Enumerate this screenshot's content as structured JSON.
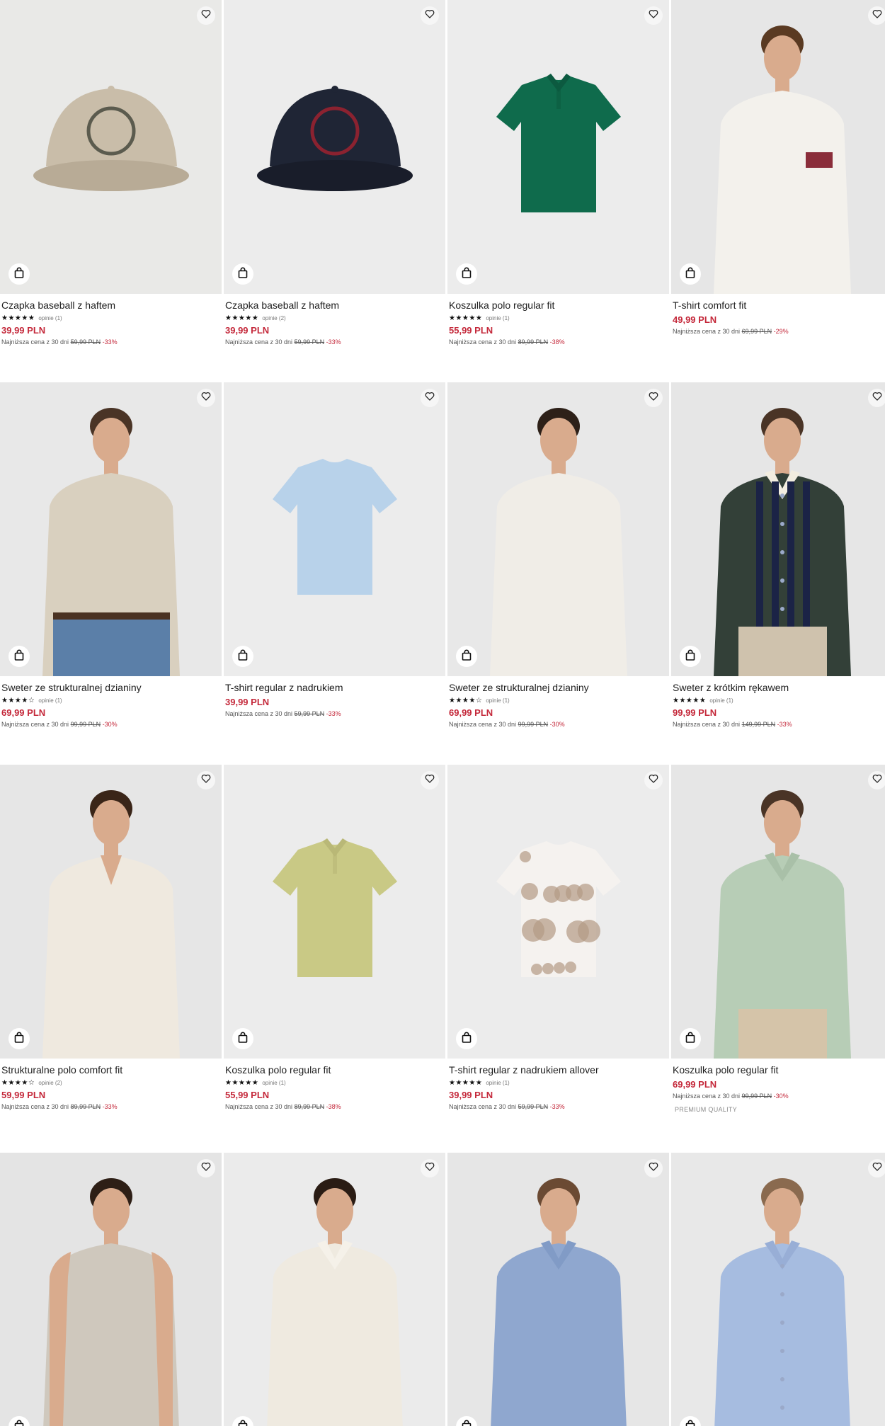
{
  "currency": "PLN",
  "lowest_label": "Najniższa cena z 30 dni",
  "reviews_word": "opinie",
  "products": [
    {
      "name": "Czapka baseball z haftem",
      "price": "39,99 PLN",
      "old_price": "59,99 PLN",
      "discount": "-33%",
      "stars": "★★★★★",
      "reviews": "opinie (1)",
      "bg": "#e9e9e7",
      "item": "cap-beige"
    },
    {
      "name": "Czapka baseball z haftem",
      "price": "39,99 PLN",
      "old_price": "59,99 PLN",
      "discount": "-33%",
      "stars": "★★★★★",
      "reviews": "opinie (2)",
      "bg": "#ececec",
      "item": "cap-navy"
    },
    {
      "name": "Koszulka polo regular fit",
      "price": "55,99 PLN",
      "old_price": "89,99 PLN",
      "discount": "-38%",
      "stars": "★★★★★",
      "reviews": "opinie (1)",
      "bg": "#ececec",
      "item": "polo-green"
    },
    {
      "name": "T-shirt comfort fit",
      "price": "49,99 PLN",
      "old_price": "69,99 PLN",
      "discount": "-29%",
      "stars": "",
      "reviews": "",
      "bg": "#e6e6e6",
      "item": "model-tee-white"
    },
    {
      "name": "Sweter ze strukturalnej dzianiny",
      "price": "69,99 PLN",
      "old_price": "99,99 PLN",
      "discount": "-30%",
      "stars": "★★★★☆",
      "reviews": "opinie (1)",
      "bg": "#e8e8e8",
      "item": "model-sweater-beige"
    },
    {
      "name": "T-shirt regular z nadrukiem",
      "price": "39,99 PLN",
      "old_price": "59,99 PLN",
      "discount": "-33%",
      "stars": "",
      "reviews": "",
      "bg": "#ececec",
      "item": "tee-lightblue"
    },
    {
      "name": "Sweter ze strukturalnej dzianiny",
      "price": "69,99 PLN",
      "old_price": "99,99 PLN",
      "discount": "-30%",
      "stars": "★★★★☆",
      "reviews": "opinie (1)",
      "bg": "#e8e8e8",
      "item": "model-sweater-white"
    },
    {
      "name": "Sweter z krótkim rękawem",
      "price": "99,99 PLN",
      "old_price": "149,99 PLN",
      "discount": "-33%",
      "stars": "★★★★★",
      "reviews": "opinie (1)",
      "bg": "#e6e6e6",
      "item": "model-stripe-shirt"
    },
    {
      "name": "Strukturalne polo comfort fit",
      "price": "59,99 PLN",
      "old_price": "89,99 PLN",
      "discount": "-33%",
      "stars": "★★★★☆",
      "reviews": "opinie (2)",
      "bg": "#e6e6e6",
      "item": "model-polo-cream"
    },
    {
      "name": "Koszulka polo regular fit",
      "price": "55,99 PLN",
      "old_price": "89,99 PLN",
      "discount": "-38%",
      "stars": "★★★★★",
      "reviews": "opinie (1)",
      "bg": "#ececec",
      "item": "polo-olive"
    },
    {
      "name": "T-shirt regular z nadrukiem allover",
      "price": "39,99 PLN",
      "old_price": "59,99 PLN",
      "discount": "-33%",
      "stars": "★★★★★",
      "reviews": "opinie (1)",
      "bg": "#ececec",
      "item": "tee-print"
    },
    {
      "name": "Koszulka polo regular fit",
      "price": "69,99 PLN",
      "old_price": "99,99 PLN",
      "discount": "-30%",
      "stars": "",
      "reviews": "",
      "bg": "#e6e6e6",
      "item": "model-polo-mint",
      "extra": "PREMIUM QUALITY"
    },
    {
      "name": "",
      "price": "",
      "old_price": "",
      "discount": "",
      "stars": "",
      "reviews": "",
      "bg": "#e4e4e4",
      "item": "model-tank"
    },
    {
      "name": "",
      "price": "",
      "old_price": "",
      "discount": "",
      "stars": "",
      "reviews": "",
      "bg": "#ebebeb",
      "item": "model-shirt-white"
    },
    {
      "name": "",
      "price": "",
      "old_price": "",
      "discount": "",
      "stars": "",
      "reviews": "",
      "bg": "#e6e6e6",
      "item": "model-polo-blue"
    },
    {
      "name": "",
      "price": "",
      "old_price": "",
      "discount": "",
      "stars": "",
      "reviews": "",
      "bg": "#e8e8e8",
      "item": "model-shirt-blue"
    }
  ]
}
